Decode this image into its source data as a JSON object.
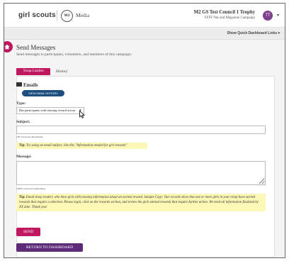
{
  "header": {
    "logo_text": "girl scouts",
    "m2_badge": "M2",
    "media_label": "Media",
    "campaign_title": "M2 GS Test Council 1 Trophy",
    "campaign_subtitle": "FFFF Nut and Magazine Campaign",
    "user_initials": "TT",
    "user_caret": "▾"
  },
  "quick_links": "Show Quick Dashboard Links ▾",
  "home_icon": "home-icon",
  "page": {
    "title": "Send Messages",
    "description": "Send messages to participants, volunteers, and members of this campaign."
  },
  "tabs": [
    {
      "label": "Troop Leaders",
      "active": true
    },
    {
      "label": "History",
      "active": false
    }
  ],
  "emails": {
    "heading": "Emails",
    "view_history_label": "VIEW EMAIL HISTORY"
  },
  "type": {
    "label": "Type:",
    "selected": "Has participants with missing reward action",
    "caret": "▾"
  },
  "subject": {
    "label": "Subject:",
    "value": "",
    "chars_remaining": "100 Characters Remaining",
    "tip_label": "Tip:",
    "tip_text": "Try using an email subject, like this \"Information needed for girl rewards\""
  },
  "message": {
    "label": "Message:",
    "value": "",
    "chars_remaining": "10000 Characters Remaining",
    "tip_label": "Tip:",
    "tip_text": "Email troop leaders who have girls with missing information about an earned reward. Sample Copy: Our records show that one or more girls in your troop have earned rewards that require a selection. Please login, click on the rewards section, and review the girls earned rewards that require further action. We need all information finalized by XX date. Thank you!"
  },
  "buttons": {
    "send": "SEND",
    "return": "RETURN TO DASHBOARD"
  },
  "colors": {
    "accent_pink": "#c0185f",
    "navy": "#1c4e80",
    "purple": "#5e2b7a",
    "tip_yellow": "#fdf8b5"
  }
}
